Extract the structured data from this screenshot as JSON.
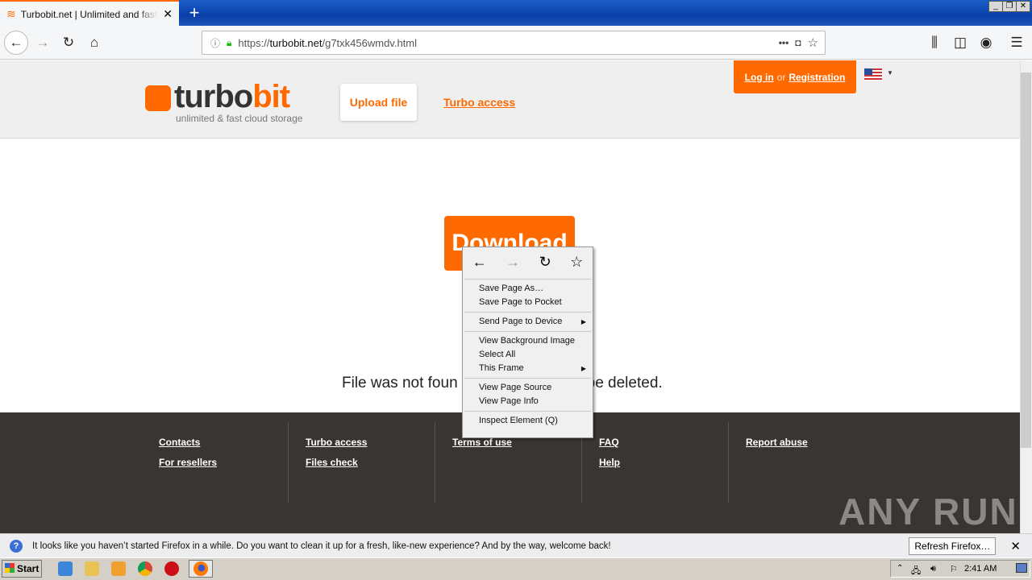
{
  "browser": {
    "tab_title": "Turbobit.net | Unlimited and fast file",
    "url_domain": "turbobit.net",
    "url_prefix": "https://",
    "url_path": "/g7txk456wmdv.html",
    "window_controls": [
      "_",
      "❐",
      "✕"
    ]
  },
  "page": {
    "logo_part1": "turbo",
    "logo_part2": "bit",
    "tagline": "unlimited & fast cloud storage",
    "upload_label": "Upload file",
    "turbo_access_label": "Turbo access",
    "login_label": "Log in",
    "or_label": "or",
    "registration_label": "Registration",
    "download_label": "Download",
    "not_found_left": "File was not foun",
    "not_found_right": "be deleted."
  },
  "footer": {
    "columns": [
      [
        "Contacts",
        "For resellers"
      ],
      [
        "Turbo access",
        "Files check"
      ],
      [
        "Terms of use"
      ],
      [
        "FAQ",
        "Help"
      ],
      [
        "Report abuse"
      ]
    ]
  },
  "context_menu": {
    "items": [
      {
        "label": "Save Page As…"
      },
      {
        "label": "Save Page to Pocket"
      },
      {
        "label": "Send Page to Device",
        "submenu": true
      },
      {
        "label": "View Background Image"
      },
      {
        "label": "Select All"
      },
      {
        "label": "This Frame",
        "submenu": true
      },
      {
        "label": "View Page Source"
      },
      {
        "label": "View Page Info"
      },
      {
        "label": "Inspect Element (Q)"
      }
    ]
  },
  "notification": {
    "message": "It looks like you haven’t started Firefox in a while. Do you want to clean it up for a fresh, like-new experience? And by the way, welcome back!",
    "button_label": "Refresh Firefox…"
  },
  "taskbar": {
    "start_label": "Start",
    "clock": "2:41 AM"
  },
  "watermark": "ANY RUN",
  "colors": {
    "brand": "#ff6a00",
    "footer_bg": "#393533"
  }
}
